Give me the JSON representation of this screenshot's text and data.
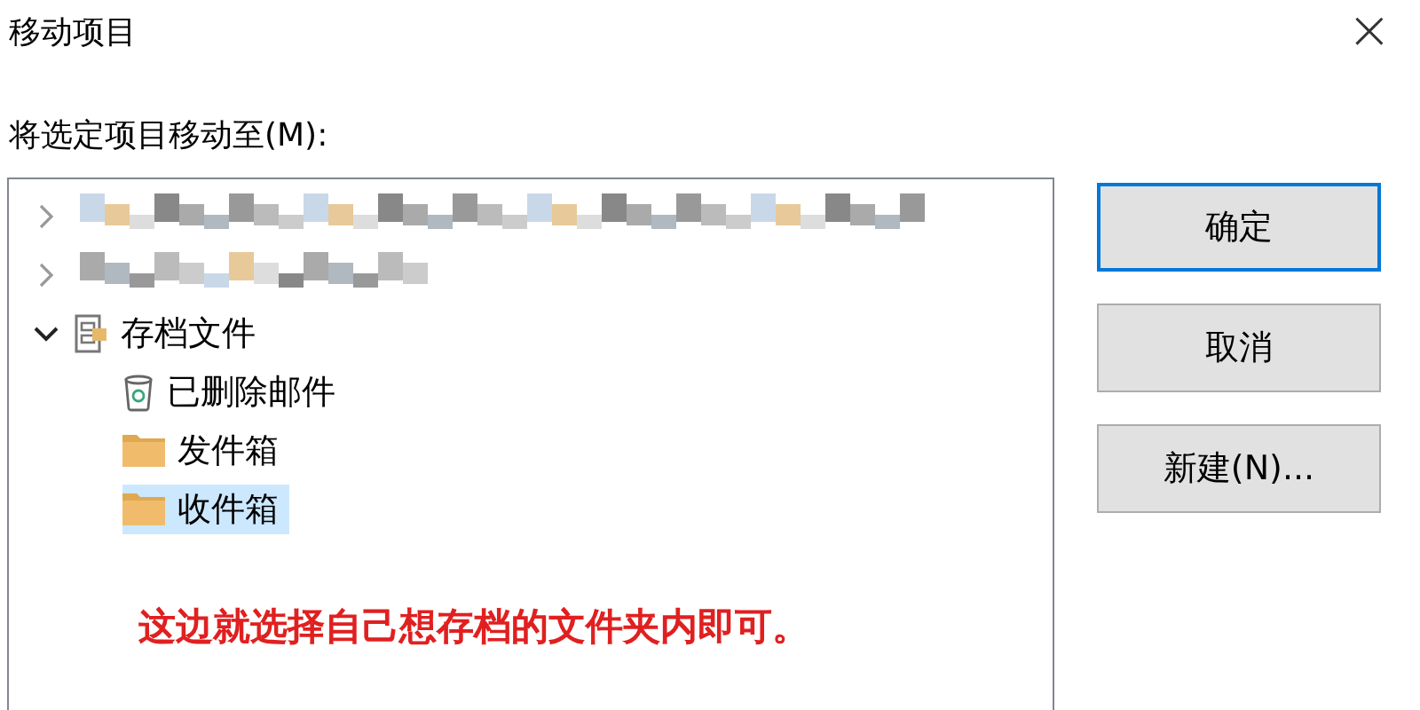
{
  "window": {
    "title": "移动项目",
    "close": "×"
  },
  "prompt": "将选定项目移动至(M):",
  "tree": [
    {
      "kind": "redacted",
      "expanded": false,
      "selected": false
    },
    {
      "kind": "redacted",
      "expanded": false,
      "selected": false
    },
    {
      "kind": "archive",
      "label": "存档文件",
      "expanded": true,
      "selected": false,
      "children": [
        {
          "kind": "trash",
          "label": "已删除邮件",
          "selected": false
        },
        {
          "kind": "folder",
          "label": "发件箱",
          "selected": false
        },
        {
          "kind": "folder",
          "label": "收件箱",
          "selected": true
        }
      ]
    }
  ],
  "annotation": "这边就选择自己想存档的文件夹内即可。",
  "buttons": [
    {
      "label": "确定",
      "default": true
    },
    {
      "label": "取消",
      "default": false
    },
    {
      "label": "新建(N)...",
      "default": false
    }
  ]
}
